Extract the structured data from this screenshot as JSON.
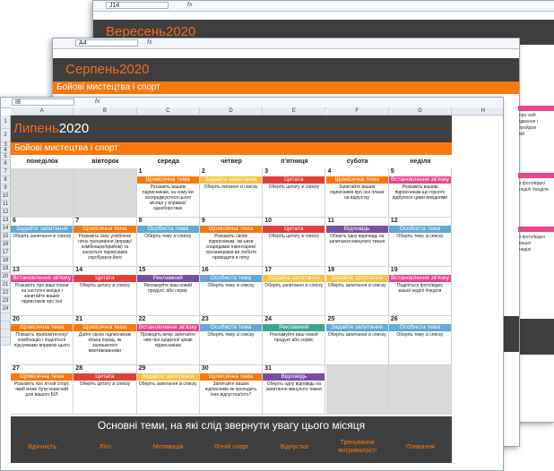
{
  "colors": {
    "dark": "#3f3f3f",
    "orange": "#f7790d",
    "title_month": "#f26a1b",
    "tag_orange": "#f7790d",
    "tag_red": "#e0403a",
    "tag_pink": "#e8458e",
    "tag_blue": "#5fa9d9",
    "tag_purple": "#7a4fa0",
    "tag_green": "#3aa68e",
    "tag_yellow": "#f5c242"
  },
  "sheet_back": {
    "cell": "J14",
    "fx": "fx",
    "title": "Вересень2020"
  },
  "sheet_mid": {
    "cell": "A4",
    "fx": "fx",
    "title": "Серпень2020",
    "category": "Бойові мистецтва і спорт"
  },
  "sheet_front": {
    "cell": "I8",
    "fx": "fx",
    "title_month": "Липень",
    "title_year": "2020",
    "category": "Бойові мистецтва і спорт",
    "columns": [
      "A",
      "B",
      "C",
      "D",
      "E",
      "F",
      "G",
      "H"
    ],
    "rows": [
      "1",
      "2",
      "3",
      "4",
      "5",
      "6",
      "7",
      "8",
      "9",
      "10",
      "11",
      "12",
      "13",
      "14",
      "15",
      "16",
      "17",
      "18",
      "19",
      "20",
      "21",
      "22",
      "23",
      "24"
    ],
    "days": [
      "понеділок",
      "вівторок",
      "середа",
      "четвер",
      "п'ятниця",
      "субота",
      "неділя"
    ],
    "weeks": [
      [
        null,
        null,
        {
          "n": "1",
          "tag": "Щомісячна тема",
          "color": "#f7790d",
          "text": "Розкажіть вашим підписникам, на чому ви зосереджуєтеся цього місяця у вправах/ одноборствах"
        },
        {
          "n": "2",
          "tag": "Задайте запитання",
          "color": "#f5c242",
          "text": "Оберіть питання зі списку"
        },
        {
          "n": "3",
          "tag": "Цитата",
          "color": "#e0403a",
          "text": "Оберіть цитату зі списку"
        },
        {
          "n": "4",
          "tag": "Щомісячна тема",
          "color": "#f7790d",
          "text": "Запитайте ваших підписників про їхні плани на відпустку"
        },
        {
          "n": "5",
          "tag": "Встановлення зв'язку",
          "color": "#e8458e",
          "text": "Розкажіть вашим підписникам що горного відбулося цими вихідними"
        }
      ],
      [
        {
          "n": "6",
          "tag": "Задайте запитання",
          "color": "#5fa9d9",
          "text": "Оберіть запитання зі списку"
        },
        {
          "n": "7",
          "tag": "Щомісячна тема",
          "color": "#f7790d",
          "text": "Розкажіть своє улюблене літнє тренування (вправу/комбінацію/прийом) та заохотьте підписників спробувати його"
        },
        {
          "n": "8",
          "tag": "Особиста тема",
          "color": "#5fa9d9",
          "text": "Оберіть тему зі списку"
        },
        {
          "n": "9",
          "tag": "Щомісячна тема",
          "color": "#f7790d",
          "text": "Розкажіть своїм підписникам, які-ьвхи снарядами/ інвентарем/ тренажерами ви любите проводити в літку"
        },
        {
          "n": "10",
          "tag": "Цитата",
          "color": "#e0403a",
          "text": "Оберіть цитату зі списку"
        },
        {
          "n": "11",
          "tag": "Відповідь",
          "color": "#7a4fa0",
          "text": "Оберіть одну відповідь на запитання минулого тижня"
        },
        {
          "n": "12",
          "tag": "Особиста тема",
          "color": "#5fa9d9",
          "text": "Оберіть тему зі списку"
        }
      ],
      [
        {
          "n": "13",
          "tag": "Встановлення зв'язку",
          "color": "#e8458e",
          "text": "Розкажіть про ваші плани на наступні вихідні і запитайте ваших підписників про їхні"
        },
        {
          "n": "14",
          "tag": "Цитата",
          "color": "#e0403a",
          "text": "Оберіть цитату зі списку"
        },
        {
          "n": "15",
          "tag": "Рекламний",
          "color": "#7a4fa0",
          "text": "Рекламуйте ваш новий продукт, або сервіс"
        },
        {
          "n": "16",
          "tag": "Особиста тема",
          "color": "#5fa9d9",
          "text": "Оберіть тему зі списку"
        },
        {
          "n": "17",
          "tag": "Задайте запитання",
          "color": "#f5c242",
          "text": "Оберіть запитання зі списку"
        },
        {
          "n": "18",
          "tag": "Задайте запитання",
          "color": "#f5c242",
          "text": "Оберіть запитання зі списку"
        },
        {
          "n": "19",
          "tag": "Встановлення зв'язку",
          "color": "#e8458e",
          "text": "Поділіться фото/відео вашої неділі #neділя"
        }
      ],
      [
        {
          "n": "20",
          "tag": "Щомісячна тема",
          "color": "#f7790d",
          "text": "Покажіть прийом/техніку/комбінацію і поділіться підсумками вправою цього"
        },
        {
          "n": "21",
          "tag": "Щомісячна тема",
          "color": "#f7790d",
          "text": "Дайте своїм підписникам кілька порад, як залишатися вмотивованими"
        },
        {
          "n": "22",
          "tag": "Встановлення зв'язку",
          "color": "#e8458e",
          "text": "Проведіть вечір запитайте чим про щоденні/ цікаві підписникам"
        },
        {
          "n": "23",
          "tag": "Особиста тема",
          "color": "#5fa9d9",
          "text": "Оберіть тему зі списку"
        },
        {
          "n": "24",
          "tag": "Рекламний",
          "color": "#3aa68e",
          "text": "Рекламуйте ваш новий продукт або сервіс"
        },
        {
          "n": "25",
          "tag": "Задайте запитання",
          "color": "#5fa9d9",
          "text": "Оберіть запитання зі списку"
        },
        {
          "n": "26",
          "tag": "Особиста тема",
          "color": "#5fa9d9",
          "text": "Оберіть тему зі списку"
        }
      ],
      [
        {
          "n": "27",
          "tag": "Щомісячна тема",
          "color": "#f7790d",
          "text": "Розкажіть про літній спорт, який може бути корисний для вашого БІЛ"
        },
        {
          "n": "28",
          "tag": "Цитата",
          "color": "#e0403a",
          "text": "Оберіть цитату зі списку"
        },
        {
          "n": "29",
          "tag": "Задайте запитання",
          "color": "#f5c242",
          "text": "Оберіть запитання зі списку"
        },
        {
          "n": "30",
          "tag": "Щомісячна тема",
          "color": "#f7790d",
          "text": "Запитайте ваших підписників як проходить їхня відпустка/літо?"
        },
        {
          "n": "31",
          "tag": "Відповідь",
          "color": "#7a4fa0",
          "text": "Оберіть одну відповідь на запитання минулого тижня"
        },
        null,
        null
      ]
    ],
    "footer_title": "Основні теми, на які слід звернути увагу цього місяця",
    "topics": [
      "Вдячність",
      "Літо",
      "Мотивація",
      "Літній спорт",
      "Відпустка",
      "Тренування витривалості",
      "Плавання"
    ]
  },
  "right_peek": {
    "lines": [
      "про свій",
      "ідження і",
      "тройдов",
      "кій",
      "",
      "",
      "",
      "",
      "",
      "з фото/відео",
      "неділі #неділя",
      "",
      "",
      "",
      "",
      "з фото/відео",
      "вашої",
      "неділі",
      "",
      "",
      "",
      "на",
      "ко"
    ]
  }
}
